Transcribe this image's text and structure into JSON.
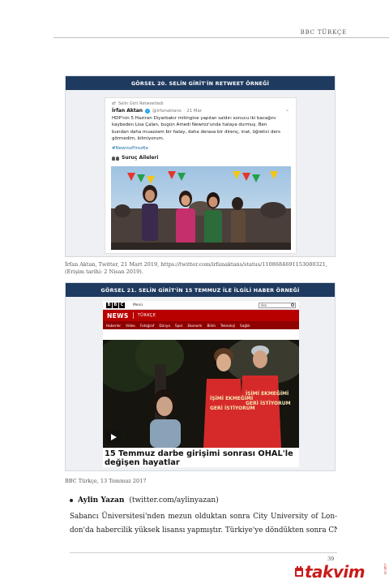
{
  "header": {
    "publisher": "BBC TÜRKÇE"
  },
  "figure20": {
    "title": "GÖRSEL 20. SELİN GİRİT'İN RETWEET ÖRNEĞİ",
    "tweet": {
      "retweeted_by": "Selin Girit Retweetledi",
      "author_name": "İrfan Aktan",
      "author_handle": "@irfanaktans",
      "date": "· 21 Mar",
      "text": "HDP'nin 5 Haziran Diyarbakır mitingine yapılan saldırı sonucu iki bacağını kaybeden Lisa Çalan, bugün Amedi Newroz'unda halaya durmuş. Ben bundan daha muazzam bir halay, daha derasa bir direnç, inat, öğretici ders görmedim, bilmiyorum.",
      "hashtag": "#NewrozPiroz6e",
      "link_label": "Suruç Aileleri"
    },
    "caption": "İrfan Aktan, Twitter, 21 Mart 2019, https://twitter.com/irfanaktans/status/1108684691153080321, (Erişim tarihi: 2 Nisan 2019)."
  },
  "figure21": {
    "title": "GÖRSEL 21. SELİN GİRİT'İN 15 TEMMUZ İLE İLGİLİ HABER ÖRNEĞİ",
    "bbc": {
      "logo_letters": [
        "B",
        "B",
        "C"
      ],
      "menu_label": "Menü",
      "search_label": "Ara",
      "section": "NEWS",
      "edition": "TÜRKÇE",
      "nav_items": [
        "Haberler",
        "Video",
        "Fotoğraf",
        "Dünya",
        "Spor",
        "Ekonomi",
        "Bilim",
        "Teknoloji",
        "Sağlık"
      ],
      "headline_line1": "15 Temmuz darbe girişimi sonrası OHAL'le",
      "headline_line2": "değişen hayatlar",
      "vest_text": [
        "İŞİMİ EKMEĞİMİ",
        "GERİ İSTİYORUM"
      ]
    },
    "caption": "BBC Türkçe, 13 Temmuz 2017"
  },
  "body": {
    "bullet_name": "Aylin Yazan",
    "bullet_handle": "(twitter.com/aylinyazan)",
    "para_lines": [
      "Sabancı Üniversitesi'nden mezun olduktan sonra City University of Lon-",
      "don'da habercilik yüksek lisansı yapmıştır. Türkiye'ye döndükten sonra CNN"
    ]
  },
  "footer": {
    "page_number": "39"
  },
  "watermark": {
    "brand": "takvim",
    "domain": ".com.tr"
  },
  "colors": {
    "figure_bar": "#1f3a5f",
    "bbc_red": "#b80000",
    "vest_red": "#d62a2a",
    "watermark": "#c91c1c"
  }
}
